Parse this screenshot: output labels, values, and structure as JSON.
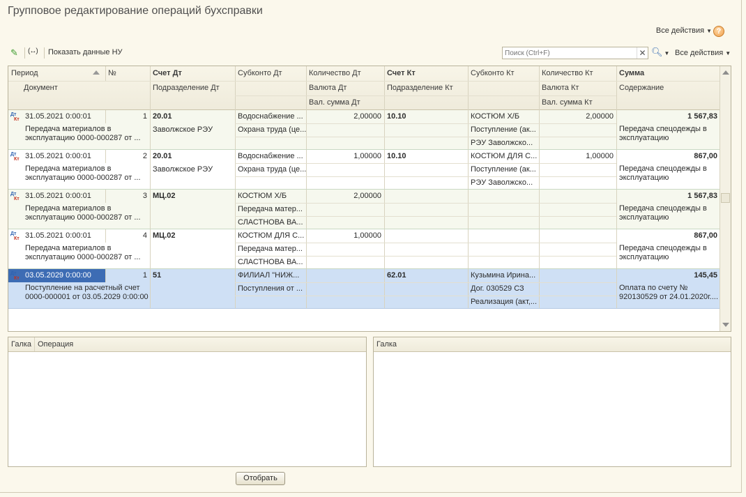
{
  "window": {
    "title": "Групповое редактирование операций бухсправки",
    "all_actions": "Все действия",
    "help": "?"
  },
  "toolbar": {
    "edit_icon": "pencil-icon",
    "arrows_label": "(↔)",
    "show_nu": "Показать данные НУ",
    "search_placeholder": "Поиск (Ctrl+F)",
    "search_clear": "✕",
    "all_actions": "Все действия"
  },
  "grid": {
    "headers": {
      "period": "Период",
      "num": "№",
      "account_dt": "Счет Дт",
      "subconto_dt": "Субконто Дт",
      "qty_dt": "Количество Дт",
      "account_kt": "Счет Кт",
      "subconto_kt": "Субконто Кт",
      "qty_kt": "Количество Кт",
      "amount": "Сумма",
      "document": "Документ",
      "division_dt": "Подразделение Дт",
      "currency_dt": "Валюта Дт",
      "division_kt": "Подразделение Кт",
      "currency_kt": "Валюта Кт",
      "content": "Содержание",
      "cur_amount_dt": "Вал. сумма Дт",
      "cur_amount_kt": "Вал. сумма Кт"
    },
    "rows": [
      {
        "period": "31.05.2021 0:00:01",
        "num": "1",
        "account_dt": "20.01",
        "subconto_dt_1": "Водоснабжение ...",
        "subconto_dt_2": "Охрана труда (це...",
        "subconto_dt_3": "",
        "qty_dt": "2,00000",
        "account_kt": "10.10",
        "subconto_kt_1": "КОСТЮМ Х/Б",
        "subconto_kt_2": "Поступление (ак...",
        "subconto_kt_3": "РЭУ Заволжско...",
        "qty_kt": "2,00000",
        "amount": "1 567,83",
        "document": "Передача материалов в эксплуатацию 0000-000287 от ...",
        "division_dt": "Заволжское РЭУ",
        "content": "Передача спецодежды в эксплуатацию"
      },
      {
        "period": "31.05.2021 0:00:01",
        "num": "2",
        "account_dt": "20.01",
        "subconto_dt_1": "Водоснабжение ...",
        "subconto_dt_2": "Охрана труда (це...",
        "subconto_dt_3": "",
        "qty_dt": "1,00000",
        "account_kt": "10.10",
        "subconto_kt_1": "КОСТЮМ ДЛЯ С...",
        "subconto_kt_2": "Поступление (ак...",
        "subconto_kt_3": "РЭУ Заволжско...",
        "qty_kt": "1,00000",
        "amount": "867,00",
        "document": "Передача материалов в эксплуатацию 0000-000287 от ...",
        "division_dt": "Заволжское РЭУ",
        "content": "Передача спецодежды в эксплуатацию"
      },
      {
        "period": "31.05.2021 0:00:01",
        "num": "3",
        "account_dt": "МЦ.02",
        "subconto_dt_1": "КОСТЮМ Х/Б",
        "subconto_dt_2": "Передача матер...",
        "subconto_dt_3": "СЛАСТНОВА ВА...",
        "qty_dt": "2,00000",
        "account_kt": "",
        "subconto_kt_1": "",
        "subconto_kt_2": "",
        "subconto_kt_3": "",
        "qty_kt": "",
        "amount": "1 567,83",
        "document": "Передача материалов в эксплуатацию 0000-000287 от ...",
        "division_dt": "",
        "content": "Передача спецодежды в эксплуатацию"
      },
      {
        "period": "31.05.2021 0:00:01",
        "num": "4",
        "account_dt": "МЦ.02",
        "subconto_dt_1": "КОСТЮМ ДЛЯ С...",
        "subconto_dt_2": "Передача матер...",
        "subconto_dt_3": "СЛАСТНОВА ВА...",
        "qty_dt": "1,00000",
        "account_kt": "",
        "subconto_kt_1": "",
        "subconto_kt_2": "",
        "subconto_kt_3": "",
        "qty_kt": "",
        "amount": "867,00",
        "document": "Передача материалов в эксплуатацию 0000-000287 от ...",
        "division_dt": "",
        "content": "Передача спецодежды в эксплуатацию"
      },
      {
        "period": "03.05.2029 0:00:00",
        "num": "1",
        "account_dt": "51",
        "subconto_dt_1": "ФИЛИАЛ \"НИЖ...",
        "subconto_dt_2": "Поступления от ...",
        "subconto_dt_3": "",
        "qty_dt": "",
        "account_kt": "62.01",
        "subconto_kt_1": "Кузьмина Ирина...",
        "subconto_kt_2": "Дог. 030529 СЗ",
        "subconto_kt_3": "Реализация (акт,...",
        "qty_kt": "",
        "amount": "145,45",
        "document": "Поступление на расчетный счет 0000-000001 от 03.05.2029 0:00:00",
        "division_dt": "",
        "content": "Оплата по счету № 920130529 от 24.01.2020г...."
      }
    ]
  },
  "bottom_left": {
    "col_flag": "Галка",
    "col_operation": "Операция"
  },
  "bottom_right": {
    "col_flag": "Галка"
  },
  "buttons": {
    "select": "Отобрать"
  },
  "colors": {
    "selected_row": "#cfe0f5",
    "selected_cell": "#3d6cb4",
    "title": "#4f4f4f"
  }
}
